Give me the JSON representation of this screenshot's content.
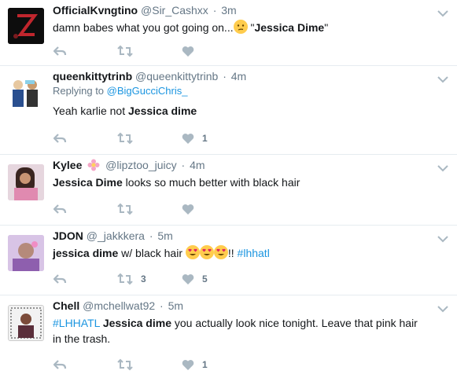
{
  "tweets": [
    {
      "name": "OfficialKvngtino",
      "handle": "@Sir_Cashxx",
      "dot": "·",
      "time": "3m",
      "text_before": "damn babes what you got going on...",
      "text_after_emoji": " \"",
      "bold": "Jessica Dime",
      "text_end": "\"",
      "reply_count": "",
      "retweet_count": "",
      "like_count": ""
    },
    {
      "name": "queenkittytrinb",
      "handle": "@queenkittytrinb",
      "dot": "·",
      "time": "4m",
      "replying_prefix": "Replying to ",
      "replying_handle": "@BigGucciChris_",
      "text_before": "Yeah karlie not ",
      "bold": "Jessica dime",
      "like_count": "1"
    },
    {
      "name": "Kylee",
      "handle": "@lipztoo_juicy",
      "dot": "·",
      "time": "4m",
      "bold": "Jessica Dime",
      "text_after": " looks so much better with black hair"
    },
    {
      "name": "JDON",
      "handle": "@_jakkkera",
      "dot": "·",
      "time": "5m",
      "bold": "jessica dime",
      "text_after": " w/ black hair ",
      "text_end": "!! ",
      "hashtag": "#lhhatl",
      "retweet_count": "3",
      "like_count": "5"
    },
    {
      "name": "Chell",
      "handle": "@mchellwat92",
      "dot": "·",
      "time": "5m",
      "hashtag": "#LHHATL",
      "bold": "Jessica dime",
      "text_after": " you actually look nice tonight. Leave that pink hair in the trash.",
      "like_count": "1"
    }
  ],
  "icons": {
    "reply": "reply-icon",
    "retweet": "retweet-icon",
    "like": "heart-icon",
    "caret": "chevron-down-icon"
  },
  "colors": {
    "icon": "#aab8c2",
    "link": "#1b95e0",
    "muted": "#657786"
  }
}
